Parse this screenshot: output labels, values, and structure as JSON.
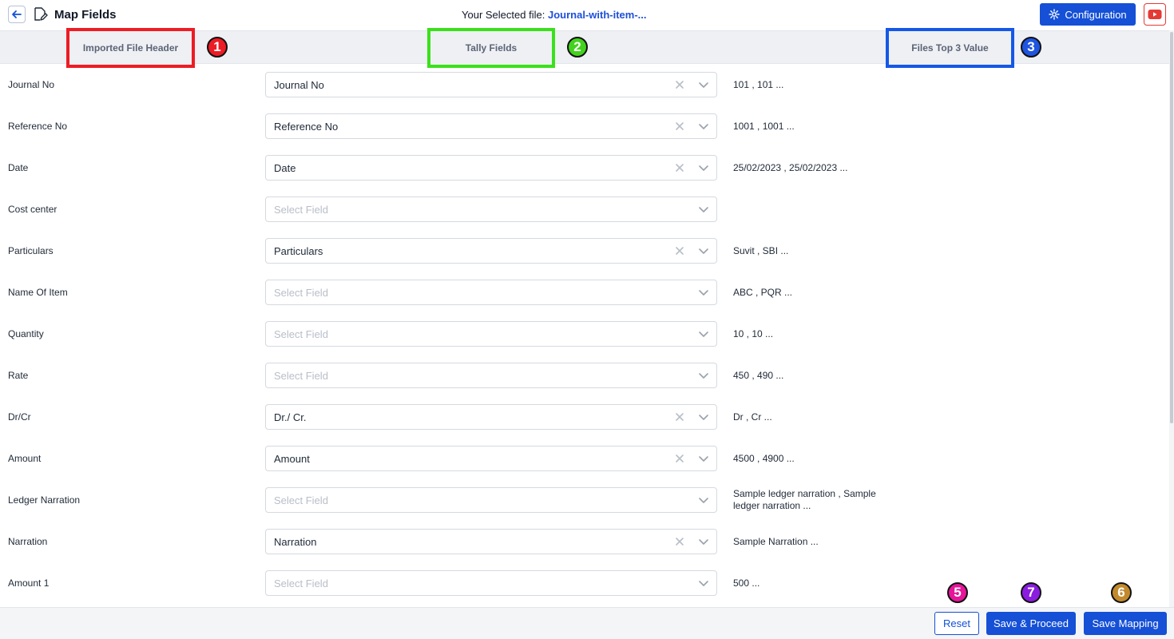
{
  "header": {
    "title": "Map Fields",
    "file_label": "Your Selected file:",
    "file_name": "Journal-with-item-...",
    "config_label": "Configuration"
  },
  "columns": {
    "imported": "Imported File Header",
    "tally": "Tally Fields",
    "top3": "Files Top 3 Value"
  },
  "badges": {
    "b1": "1",
    "b2": "2",
    "b3": "3",
    "b5": "5",
    "b6": "6",
    "b7": "7"
  },
  "colors": {
    "primary": "#1550d6",
    "badge1": "#ec1c24",
    "badge2": "#43d21e",
    "badge3": "#1f55e0",
    "badge5": "#e6159a",
    "badge6": "#c28a2c",
    "badge7": "#8a1de0"
  },
  "select_placeholder": "Select Field",
  "rows": [
    {
      "label": "Journal No",
      "value": "Journal No",
      "sample": "101 , 101 ..."
    },
    {
      "label": "Reference No",
      "value": "Reference No",
      "sample": "1001 , 1001 ..."
    },
    {
      "label": "Date",
      "value": "Date",
      "sample": "25/02/2023 , 25/02/2023 ..."
    },
    {
      "label": "Cost center",
      "value": "",
      "sample": ""
    },
    {
      "label": "Particulars",
      "value": "Particulars",
      "sample": "Suvit , SBI ..."
    },
    {
      "label": "Name Of Item",
      "value": "",
      "sample": "ABC , PQR ..."
    },
    {
      "label": "Quantity",
      "value": "",
      "sample": "10 , 10 ..."
    },
    {
      "label": "Rate",
      "value": "",
      "sample": "450 , 490 ..."
    },
    {
      "label": "Dr/Cr",
      "value": "Dr./ Cr.",
      "sample": "Dr , Cr ..."
    },
    {
      "label": "Amount",
      "value": "Amount",
      "sample": "4500 , 4900 ..."
    },
    {
      "label": "Ledger Narration",
      "value": "",
      "sample": "Sample ledger narration , Sample ledger narration ..."
    },
    {
      "label": "Narration",
      "value": "Narration",
      "sample": "Sample Narration ..."
    },
    {
      "label": "Amount 1",
      "value": "",
      "sample": "500 ..."
    }
  ],
  "footer": {
    "reset": "Reset",
    "save_proceed": "Save & Proceed",
    "save_mapping": "Save Mapping"
  }
}
